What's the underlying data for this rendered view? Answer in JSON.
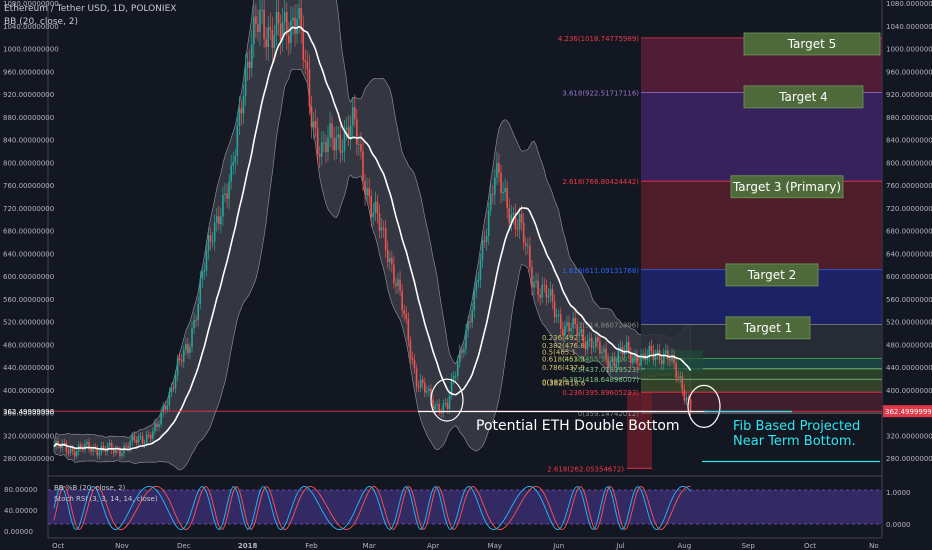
{
  "header": {
    "title": "Ethereum / Tether USD, 1D, POLONIEX",
    "bb_label": "BB (20, close, 2)"
  },
  "colors": {
    "background": "#131722",
    "candle_up": "#26a69a",
    "candle_down": "#ef5350",
    "bb_basis": "#ffffff",
    "bb_fill": "#5d6068",
    "price_line": "#e0394a",
    "osc_band": "#3a2e6e",
    "stoch_k": "#24b8ff",
    "stoch_d": "#ff5252",
    "target_box": "#4e6a3a",
    "annotation": "#ffffff",
    "annotation_cyan": "#2ee6f0"
  },
  "chart_data": {
    "type": "candlestick",
    "symbol": "ETHUSDT",
    "ylim": [
      260,
      1080
    ],
    "y_ticks": [
      "1080.00000000",
      "1040.00000000",
      "1000.00000000",
      "960.00000000",
      "920.00000000",
      "880.00000000",
      "840.00000000",
      "800.00000000",
      "760.00000000",
      "720.00000000",
      "680.00000000",
      "640.00000000",
      "600.00000000",
      "560.00000000",
      "520.00000000",
      "480.00000000",
      "440.00000000",
      "400.00000000",
      "360.00000000",
      "320.00000000",
      "280.00000000"
    ],
    "x_ticks": [
      {
        "label": "Oct",
        "idx": 2
      },
      {
        "label": "Nov",
        "idx": 33
      },
      {
        "label": "Dec",
        "idx": 63
      },
      {
        "label": "2018",
        "idx": 94
      },
      {
        "label": "Feb",
        "idx": 125
      },
      {
        "label": "Mar",
        "idx": 153
      },
      {
        "label": "Apr",
        "idx": 184
      },
      {
        "label": "May",
        "idx": 214
      },
      {
        "label": "Jun",
        "idx": 245
      },
      {
        "label": "Jul",
        "idx": 275
      },
      {
        "label": "Aug",
        "idx": 306
      },
      {
        "label": "Sep",
        "idx": 337
      },
      {
        "label": "Oct",
        "idx": 367
      },
      {
        "label": "No",
        "idx": 398
      }
    ],
    "anchors": [
      [
        0,
        300
      ],
      [
        10,
        295
      ],
      [
        20,
        298
      ],
      [
        30,
        292
      ],
      [
        40,
        310
      ],
      [
        50,
        330
      ],
      [
        60,
        440
      ],
      [
        65,
        470
      ],
      [
        72,
        600
      ],
      [
        80,
        720
      ],
      [
        86,
        760
      ],
      [
        92,
        950
      ],
      [
        100,
        1050
      ],
      [
        110,
        1020
      ],
      [
        118,
        1070
      ],
      [
        124,
        900
      ],
      [
        130,
        820
      ],
      [
        140,
        850
      ],
      [
        146,
        860
      ],
      [
        154,
        720
      ],
      [
        162,
        650
      ],
      [
        168,
        560
      ],
      [
        176,
        420
      ],
      [
        184,
        375
      ],
      [
        191,
        370
      ],
      [
        198,
        480
      ],
      [
        204,
        550
      ],
      [
        210,
        700
      ],
      [
        214,
        780
      ],
      [
        218,
        740
      ],
      [
        226,
        690
      ],
      [
        232,
        600
      ],
      [
        240,
        560
      ],
      [
        248,
        510
      ],
      [
        256,
        500
      ],
      [
        264,
        470
      ],
      [
        272,
        450
      ],
      [
        278,
        470
      ],
      [
        286,
        450
      ],
      [
        292,
        470
      ],
      [
        298,
        455
      ],
      [
        304,
        420
      ],
      [
        309,
        365
      ]
    ],
    "current_price": "362.49999998",
    "fib_levels_projection": [
      {
        "label": "4.236(1018.74775989)",
        "price": 1018.75,
        "color": "#f23645"
      },
      {
        "label": "3.618(922.51717116)",
        "price": 922.52,
        "color": "#9575cd"
      },
      {
        "label": "2.618(766.80424442)",
        "price": 766.8,
        "color": "#f23645"
      },
      {
        "label": "1.618(611.09131768)",
        "price": 611.09,
        "color": "#2962ff"
      },
      {
        "label": "1(514.86072896)",
        "price": 514.86,
        "color": "#888888"
      },
      {
        "label": "0.618(455.38781039)",
        "price": 455.39,
        "color": "#4caf50"
      },
      {
        "label": "0.5(437.01839523)",
        "price": 437.02,
        "color": "#81c784"
      },
      {
        "label": "0.382(418.64898007)",
        "price": 418.65,
        "color": "#81c784"
      },
      {
        "label": "0.236(395.89605293)",
        "price": 395.9,
        "color": "#f23645"
      },
      {
        "label": "0(359.14742012)",
        "price": 359.15,
        "color": "#888888"
      }
    ],
    "fib_bottom": {
      "label": "2.618(262.05354672)",
      "price": 262.05
    },
    "fib_retrace_labels": [
      {
        "label": "0.236(492.1",
        "price": 493
      },
      {
        "label": "0.382(476.8",
        "price": 479
      },
      {
        "label": "0.5(465.1",
        "price": 467
      },
      {
        "label": "0.618(453.3",
        "price": 455
      },
      {
        "label": "0.786(437.9",
        "price": 440
      },
      {
        "label": "0(382.5",
        "price": 415
      },
      {
        "label": "0(382(418.6",
        "price": 413
      }
    ],
    "targets": [
      {
        "label": "Target 5",
        "price": 1008
      },
      {
        "label": "Target 4",
        "price": 915
      },
      {
        "label": "Target 3 (Primary)",
        "price": 757
      },
      {
        "label": "Target 2",
        "price": 602
      },
      {
        "label": "Target 1",
        "price": 509
      }
    ],
    "annotations": {
      "double_bottom": "Potential ETH Double Bottom",
      "fib_bottom_line1": "Fib Based Projected",
      "fib_bottom_line2": "Near Term Bottom."
    },
    "oscillator": {
      "bb_pct_label": "BB %B (20, close, 2)",
      "stoch_label": "Stoch RSI (3, 3, 14, 14, close)",
      "left_ticks": [
        "80.00000",
        "40.00000",
        "0.00000"
      ],
      "right_ticks": [
        "1.0000",
        "0.0000"
      ]
    }
  }
}
